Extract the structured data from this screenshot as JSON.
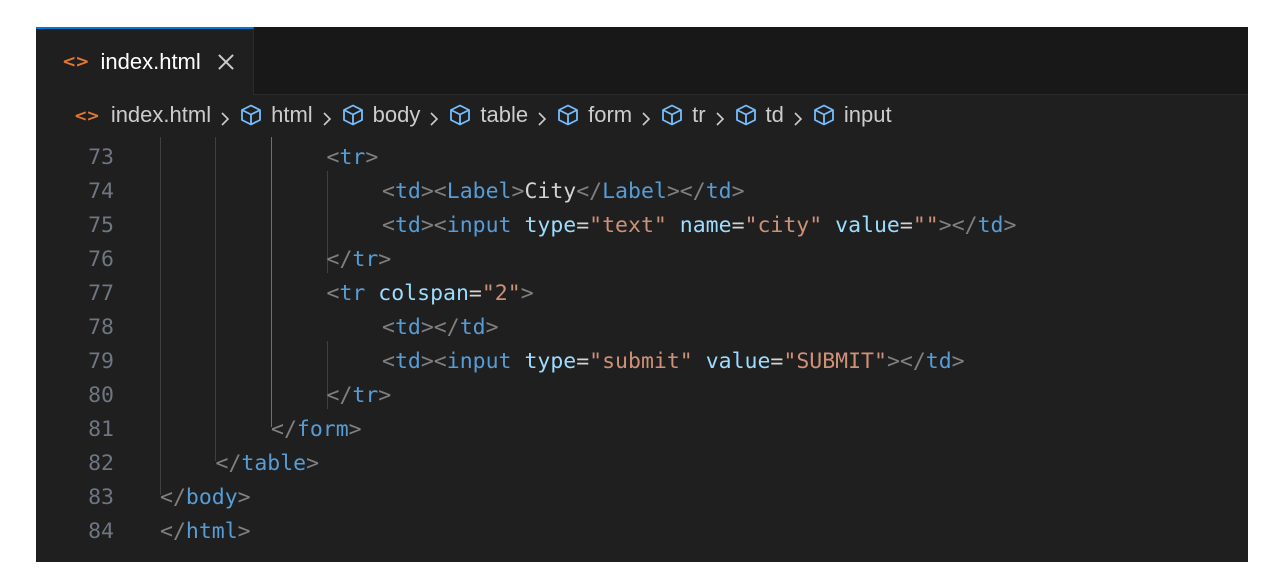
{
  "tab": {
    "filename": "index.html",
    "icon": "html-file-icon"
  },
  "breadcrumb": {
    "file": "index.html",
    "items": [
      "html",
      "body",
      "table",
      "form",
      "tr",
      "td",
      "input"
    ],
    "icon": "symbol-element-icon"
  },
  "editor": {
    "lines": [
      {
        "number": "73",
        "indent": 3,
        "tokens": [
          [
            "p",
            "<"
          ],
          [
            "t",
            "tr"
          ],
          [
            "p",
            ">"
          ]
        ]
      },
      {
        "number": "74",
        "indent": 4,
        "tokens": [
          [
            "p",
            "<"
          ],
          [
            "t",
            "td"
          ],
          [
            "p",
            ">"
          ],
          [
            "p",
            "<"
          ],
          [
            "t",
            "Label"
          ],
          [
            "p",
            ">"
          ],
          [
            "x",
            "City"
          ],
          [
            "p",
            "</"
          ],
          [
            "t",
            "Label"
          ],
          [
            "p",
            ">"
          ],
          [
            "p",
            "</"
          ],
          [
            "t",
            "td"
          ],
          [
            "p",
            ">"
          ]
        ]
      },
      {
        "number": "75",
        "indent": 4,
        "tokens": [
          [
            "p",
            "<"
          ],
          [
            "t",
            "td"
          ],
          [
            "p",
            ">"
          ],
          [
            "p",
            "<"
          ],
          [
            "t",
            "input"
          ],
          [
            "x",
            " "
          ],
          [
            "a",
            "type"
          ],
          [
            "eq",
            "="
          ],
          [
            "s",
            "\"text\""
          ],
          [
            "x",
            " "
          ],
          [
            "a",
            "name"
          ],
          [
            "eq",
            "="
          ],
          [
            "s",
            "\"city\""
          ],
          [
            "x",
            " "
          ],
          [
            "a",
            "value"
          ],
          [
            "eq",
            "="
          ],
          [
            "s",
            "\"\""
          ],
          [
            "p",
            ">"
          ],
          [
            "p",
            "</"
          ],
          [
            "t",
            "td"
          ],
          [
            "p",
            ">"
          ]
        ]
      },
      {
        "number": "76",
        "indent": 3,
        "tokens": [
          [
            "p",
            "</"
          ],
          [
            "t",
            "tr"
          ],
          [
            "p",
            ">"
          ]
        ]
      },
      {
        "number": "77",
        "indent": 3,
        "tokens": [
          [
            "p",
            "<"
          ],
          [
            "t",
            "tr"
          ],
          [
            "x",
            " "
          ],
          [
            "a",
            "colspan"
          ],
          [
            "eq",
            "="
          ],
          [
            "s",
            "\"2\""
          ],
          [
            "p",
            ">"
          ]
        ]
      },
      {
        "number": "78",
        "indent": 4,
        "tokens": [
          [
            "p",
            "<"
          ],
          [
            "t",
            "td"
          ],
          [
            "p",
            ">"
          ],
          [
            "p",
            "</"
          ],
          [
            "t",
            "td"
          ],
          [
            "p",
            ">"
          ]
        ]
      },
      {
        "number": "79",
        "indent": 4,
        "tokens": [
          [
            "p",
            "<"
          ],
          [
            "t",
            "td"
          ],
          [
            "p",
            ">"
          ],
          [
            "p",
            "<"
          ],
          [
            "t",
            "input"
          ],
          [
            "x",
            " "
          ],
          [
            "a",
            "type"
          ],
          [
            "eq",
            "="
          ],
          [
            "s",
            "\"submit\""
          ],
          [
            "x",
            " "
          ],
          [
            "a",
            "value"
          ],
          [
            "eq",
            "="
          ],
          [
            "s",
            "\"SUBMIT\""
          ],
          [
            "p",
            ">"
          ],
          [
            "p",
            "</"
          ],
          [
            "t",
            "td"
          ],
          [
            "p",
            ">"
          ]
        ]
      },
      {
        "number": "80",
        "indent": 3,
        "tokens": [
          [
            "p",
            "</"
          ],
          [
            "t",
            "tr"
          ],
          [
            "p",
            ">"
          ]
        ]
      },
      {
        "number": "81",
        "indent": 2,
        "tokens": [
          [
            "p",
            "</"
          ],
          [
            "t",
            "form"
          ],
          [
            "p",
            ">"
          ]
        ]
      },
      {
        "number": "82",
        "indent": 1,
        "tokens": [
          [
            "p",
            "</"
          ],
          [
            "t",
            "table"
          ],
          [
            "p",
            ">"
          ]
        ]
      },
      {
        "number": "83",
        "indent": 0,
        "tokens": [
          [
            "p",
            "</"
          ],
          [
            "t",
            "body"
          ],
          [
            "p",
            ">"
          ]
        ]
      },
      {
        "number": "84",
        "indent": 0,
        "tokens": [
          [
            "p",
            "</"
          ],
          [
            "t",
            "html"
          ],
          [
            "p",
            ">"
          ]
        ]
      }
    ]
  },
  "colors": {
    "editor_background": "#1f1f1f",
    "tag": "#569cd6",
    "attribute": "#9cdcfe",
    "string": "#ce9178",
    "punctuation": "#808080",
    "line_number": "#6e7681",
    "html_icon": "#e37933",
    "breadcrumb_icon": "#75beff",
    "active_tab_border": "#0078d4"
  }
}
